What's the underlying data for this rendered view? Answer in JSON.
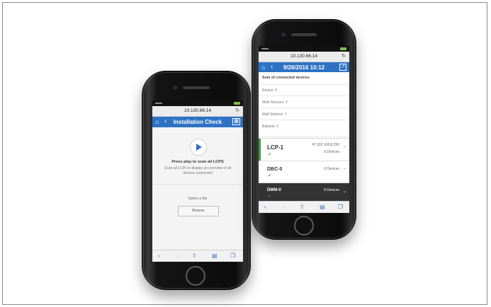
{
  "phone_left": {
    "url": "10.130.66.14",
    "nav_title": "Installation Check",
    "heading": "Press play to scan all LCPS",
    "description": "Scan all LCPs to display an overview of all devices connected",
    "select_label": "Select a file",
    "browse_label": "Browse"
  },
  "phone_right": {
    "url": "10.130.66.14",
    "nav_title": "9/26/2016 10:12",
    "summary_title": "Sum of connected devices",
    "summary_rows": [
      "Relays: 4",
      "Multi Sensors: 2",
      "Wall Stations: 1",
      "Ballasts: 2"
    ],
    "devices": [
      {
        "name": "LCP-1",
        "ip": "IP:192.168.8.250",
        "count": "9 Devices"
      },
      {
        "name": "DBC-0",
        "count": "9 Devices"
      },
      {
        "name": "DMM-0",
        "count": "9 Devices"
      }
    ]
  },
  "colors": {
    "accent": "#2e72c5",
    "ok": "#3aa13a"
  },
  "icons": [
    "home-icon",
    "back-icon",
    "chart-icon",
    "share-icon",
    "reload-icon",
    "play-icon",
    "checkmark-icon",
    "chevron-up-icon",
    "chevron-down-icon",
    "bookmarks-icon",
    "tabs-icon"
  ]
}
